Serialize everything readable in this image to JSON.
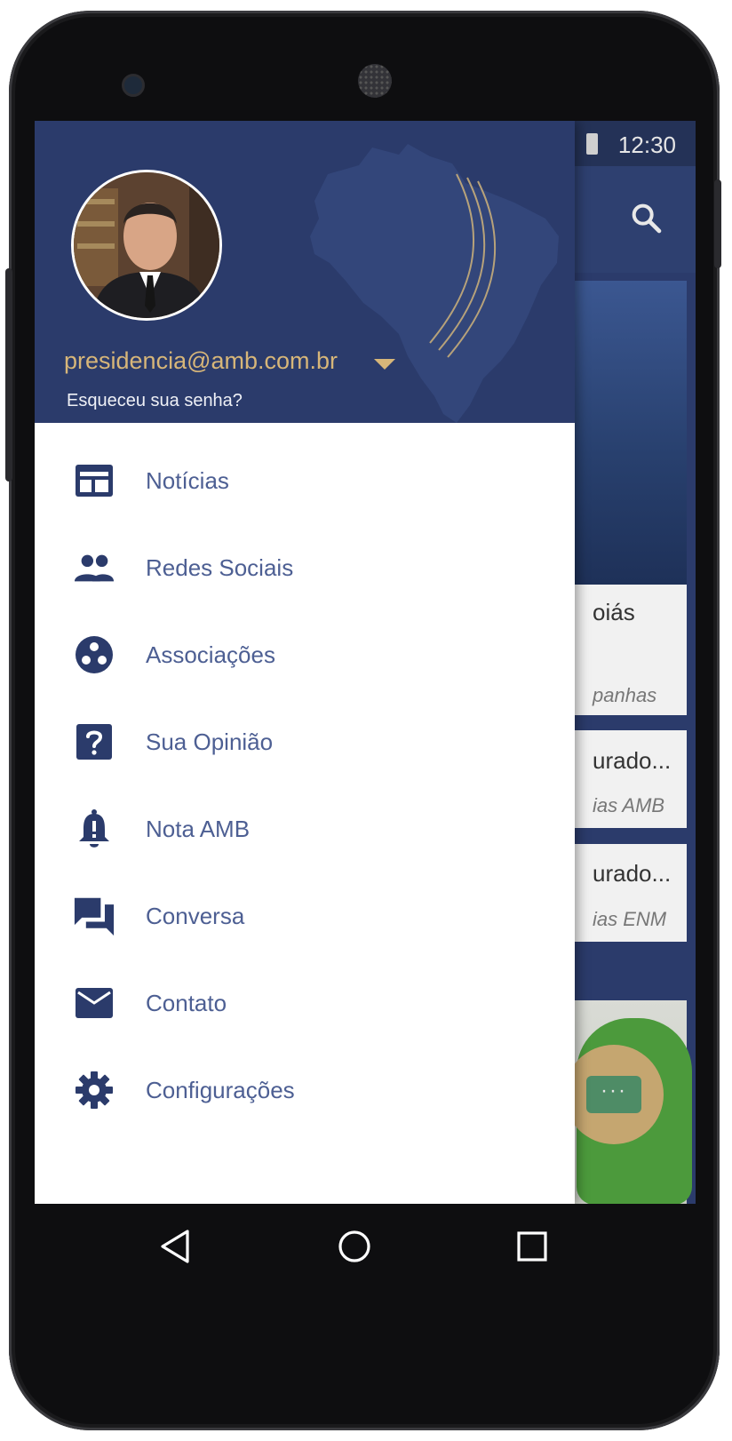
{
  "status_bar": {
    "time": "12:30"
  },
  "background_app": {
    "cards": [
      {
        "title": "oiás",
        "subtitle": "panhas"
      },
      {
        "title": "urado...",
        "subtitle": "ias AMB"
      },
      {
        "title": "urado...",
        "subtitle": "ias ENM"
      }
    ],
    "fab_label": "···"
  },
  "drawer": {
    "account_email": "presidencia@amb.com.br",
    "forgot_password": "Esqueceu sua senha?",
    "menu": [
      {
        "label": "Notícias",
        "icon": "newspaper-icon"
      },
      {
        "label": "Redes Sociais",
        "icon": "people-icon"
      },
      {
        "label": "Associações",
        "icon": "group-work-icon"
      },
      {
        "label": "Sua Opinião",
        "icon": "help-box-icon"
      },
      {
        "label": "Nota AMB",
        "icon": "bell-alert-icon"
      },
      {
        "label": "Conversa",
        "icon": "forum-icon"
      },
      {
        "label": "Contato",
        "icon": "mail-icon"
      },
      {
        "label": "Configurações",
        "icon": "gear-icon"
      }
    ]
  },
  "colors": {
    "header_blue": "#2b3b6b",
    "accent_gold": "#d7b679",
    "menu_text": "#4d5f93",
    "menu_icon": "#2b3b6b"
  }
}
